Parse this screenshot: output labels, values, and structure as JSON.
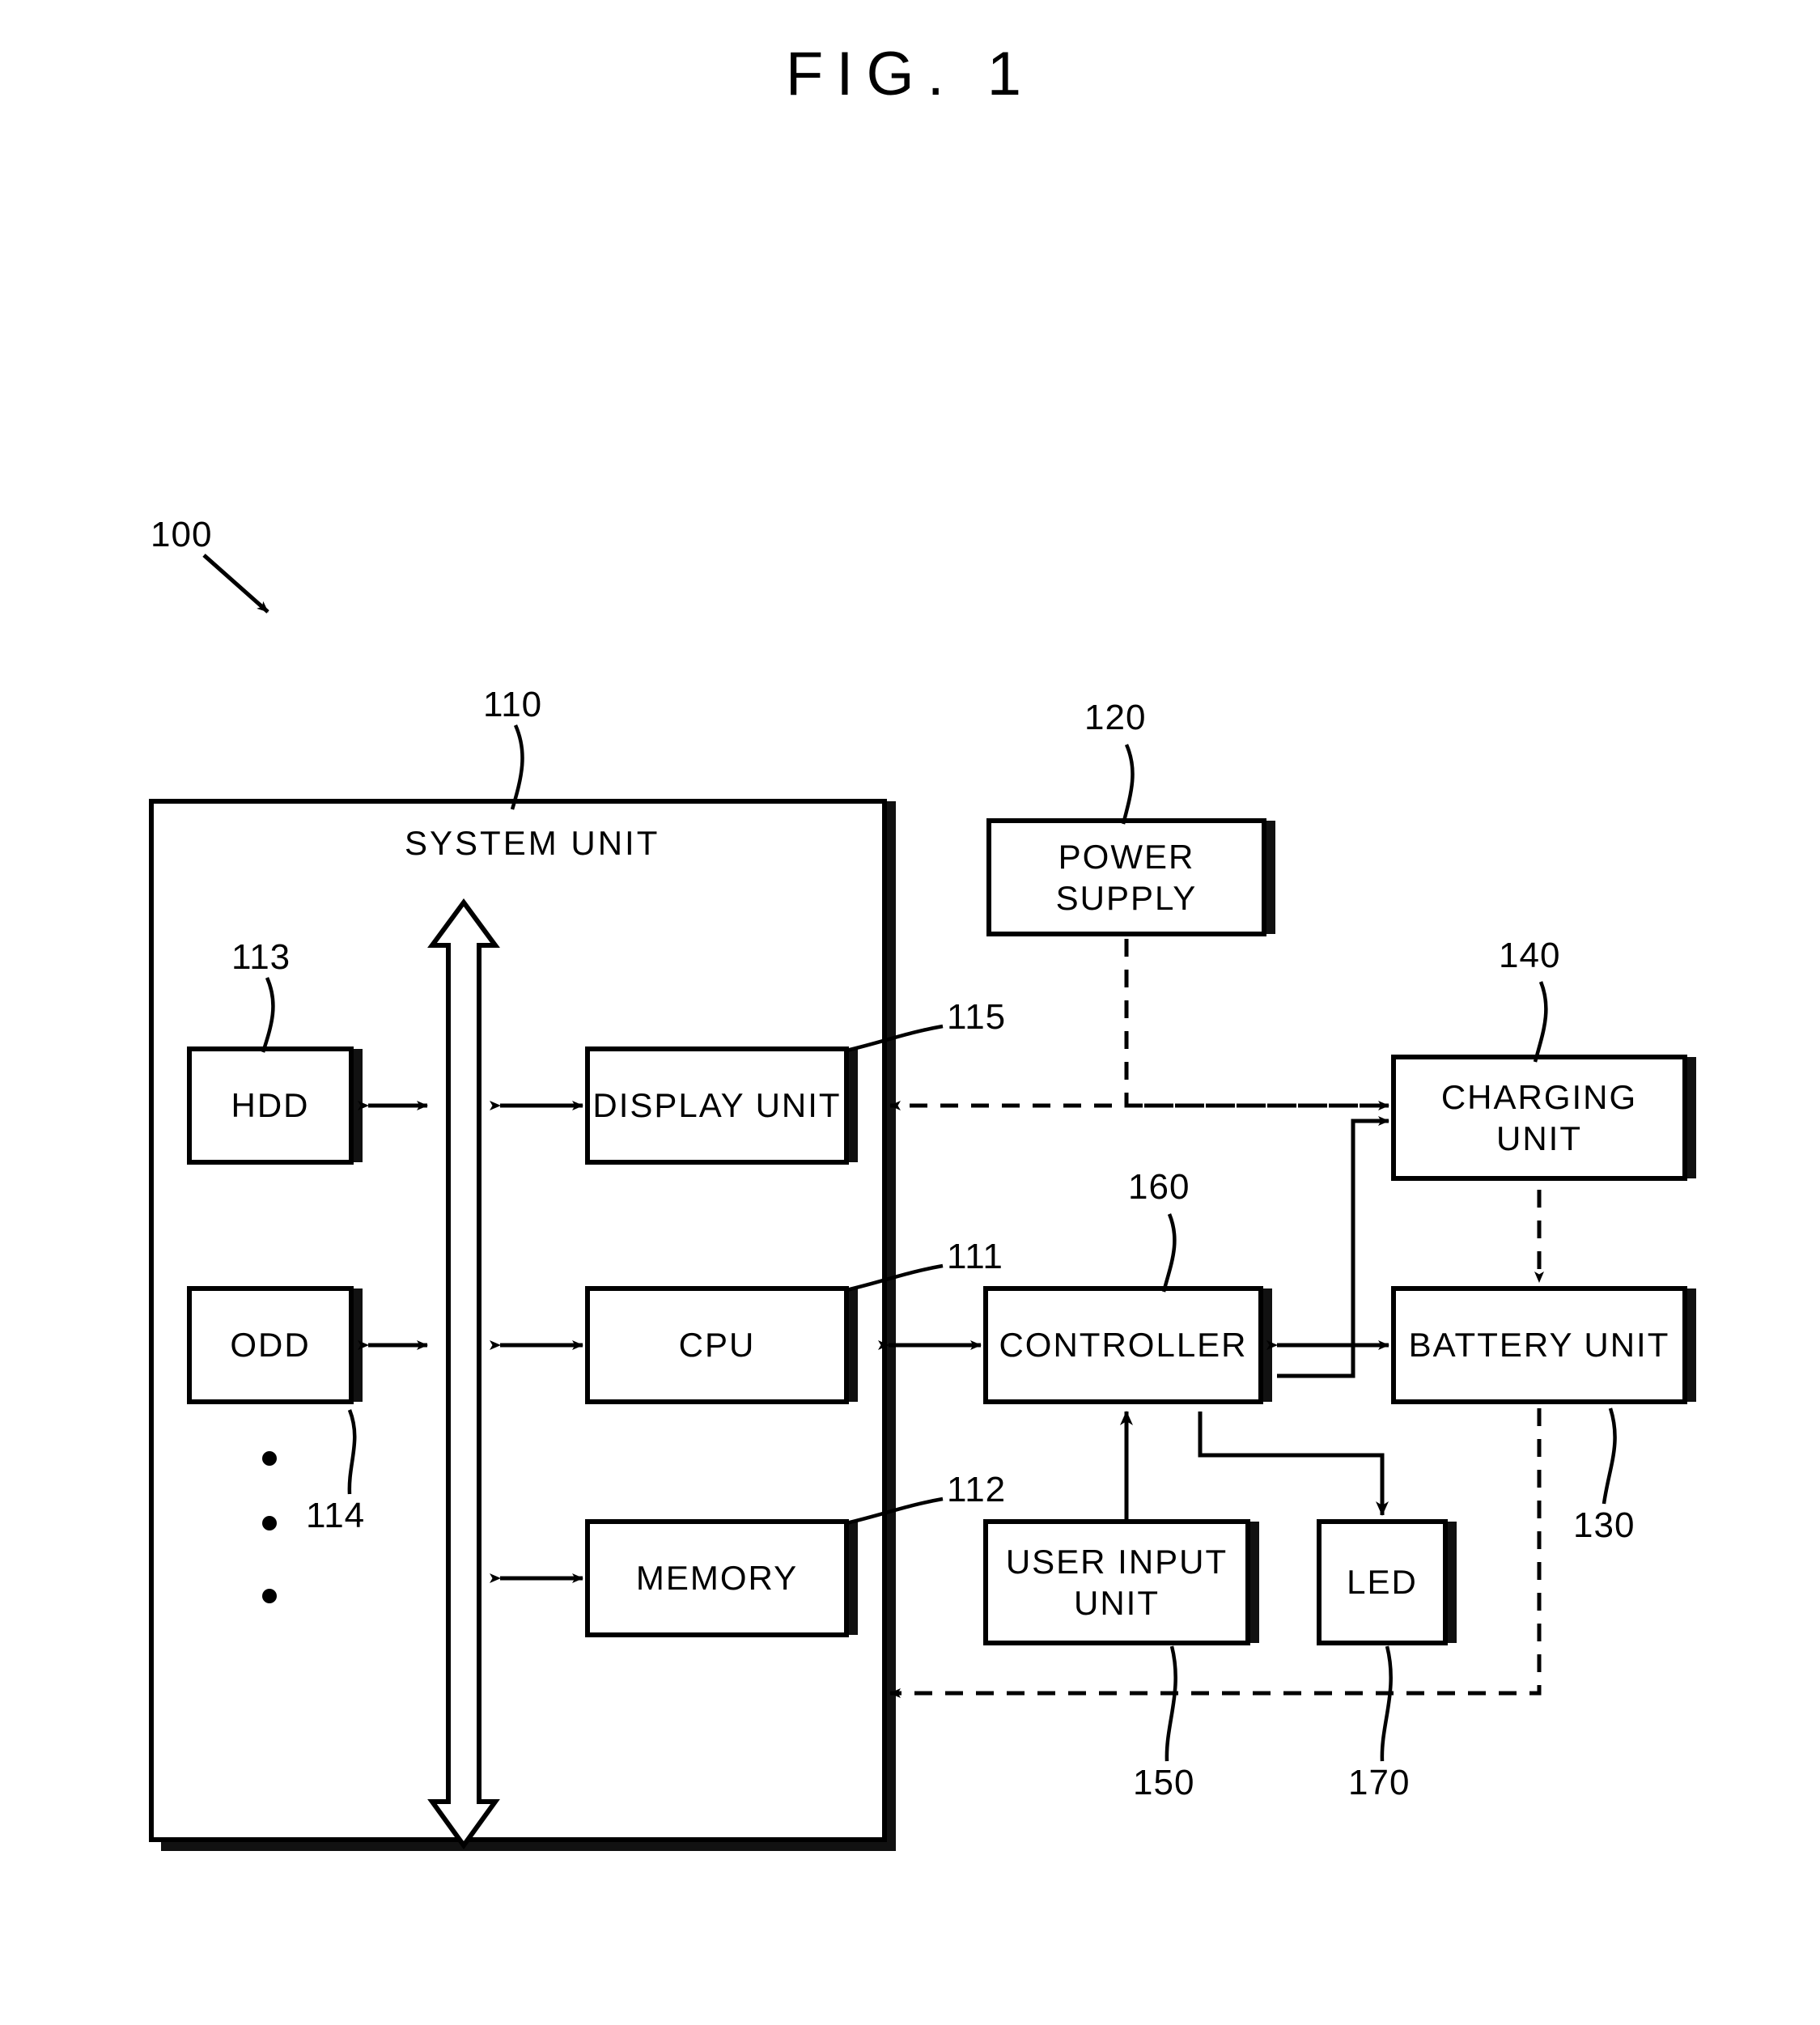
{
  "figure": {
    "title": "FIG. 1",
    "system_label": "100"
  },
  "system_unit": {
    "title": "SYSTEM UNIT",
    "ref": "110",
    "bus": {
      "name": "system-bus",
      "direction": "bidirectional-vertical"
    }
  },
  "blocks": {
    "hdd": {
      "label": "HDD",
      "ref": "113"
    },
    "odd": {
      "label": "ODD",
      "ref": "114"
    },
    "display_unit": {
      "label": "DISPLAY UNIT",
      "ref": "115"
    },
    "cpu": {
      "label": "CPU",
      "ref": "111"
    },
    "memory": {
      "label": "MEMORY",
      "ref": "112"
    },
    "power_supply": {
      "label": "POWER SUPPLY",
      "ref": "120"
    },
    "charging_unit": {
      "label": "CHARGING\nUNIT",
      "ref": "140"
    },
    "battery_unit": {
      "label": "BATTERY UNIT",
      "ref": "130"
    },
    "controller": {
      "label": "CONTROLLER",
      "ref": "160"
    },
    "user_input": {
      "label": "USER INPUT\nUNIT",
      "ref": "150"
    },
    "led": {
      "label": "LED",
      "ref": "170"
    }
  },
  "ellipsis": {
    "label": "vertical-dots",
    "count": 3
  },
  "colors": {
    "ink": "#000000",
    "paper": "#ffffff",
    "shadow": "#1a1a1a"
  }
}
